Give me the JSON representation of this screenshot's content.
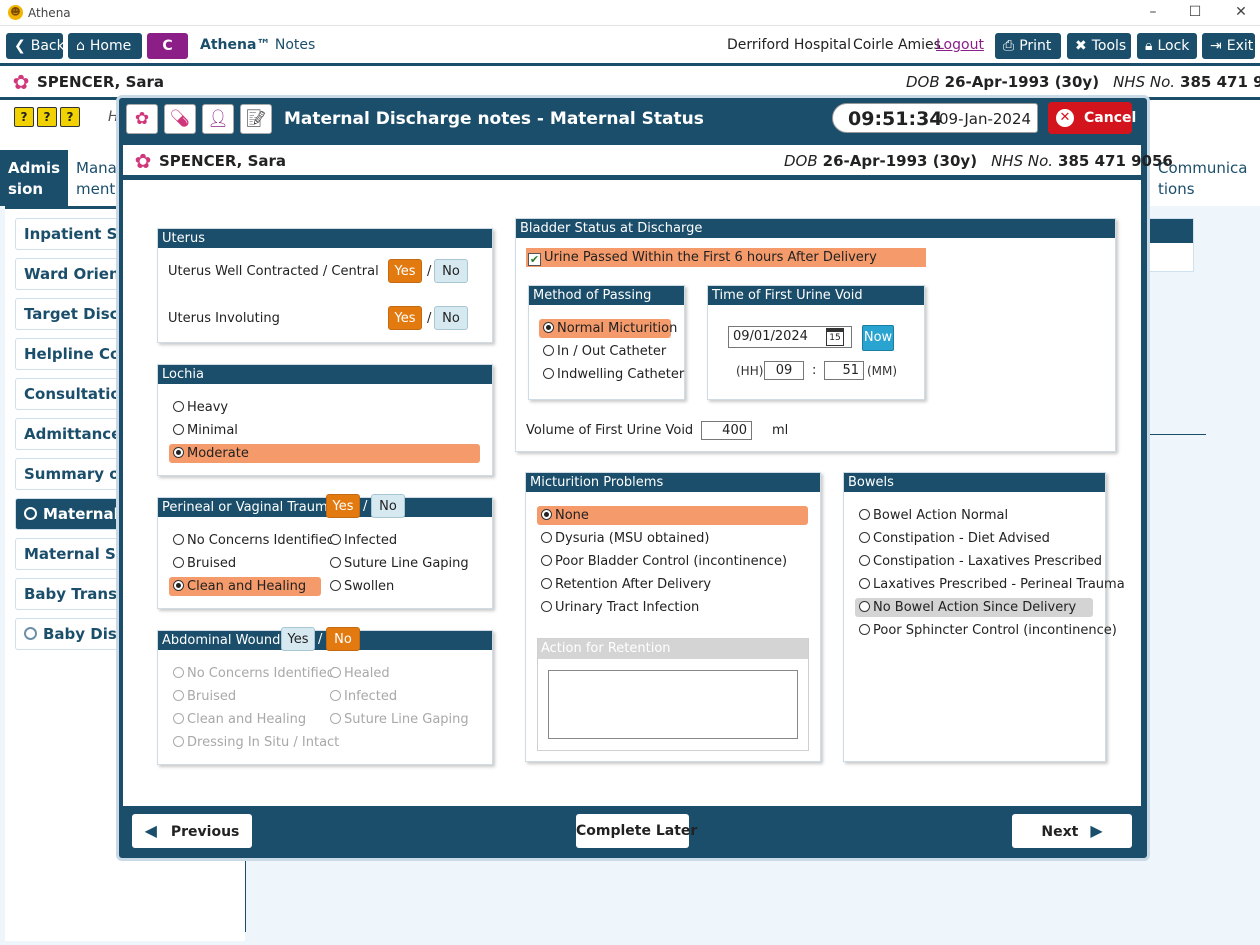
{
  "window": {
    "app_name": "Athena",
    "logo": "athena-logo",
    "minimize": "–",
    "maximize": "☐",
    "close": "✕"
  },
  "toolbar": {
    "back": "Back",
    "home": "Home",
    "c_label": "C",
    "product": "Athena™",
    "product_sub": "Notes",
    "hospital": "Derriford Hospital",
    "user": "Coirle Amies",
    "logout": "Logout",
    "print": "Print",
    "tools": "Tools",
    "lock": "Lock",
    "exit": "Exit"
  },
  "patient": {
    "name": "SPENCER, Sara",
    "dob_label": "DOB",
    "dob": "26-Apr-1993 (30y)",
    "nhs_label": "NHS No.",
    "nhs": "385 471 9056"
  },
  "help_icons": [
    "?",
    "?",
    "?"
  ],
  "background": {
    "tabs": {
      "admission": "Admis sion",
      "management": "Mana ment",
      "communications": "Communica tions"
    },
    "header_fragment": "H",
    "left_items": [
      {
        "label": "Inpatient Stay"
      },
      {
        "label": "Ward Orientat"
      },
      {
        "label": "Target Dischar"
      },
      {
        "label": "Helpline Conta"
      },
      {
        "label": "Consultation N"
      },
      {
        "label": "Admittance N"
      },
      {
        "label": "Summary of P"
      },
      {
        "label": "Maternal Di"
      },
      {
        "label": "Maternal Self"
      },
      {
        "label": "Baby Transfer"
      },
      {
        "label": "Baby Discha"
      }
    ]
  },
  "modal": {
    "title": "Maternal Discharge notes - Maternal Status",
    "time": "09:51:34",
    "date": "09-Jan-2024",
    "cancel": "Cancel",
    "uterus": {
      "title": "Uterus",
      "rows": [
        {
          "label": "Uterus Well Contracted / Central",
          "yes": "Yes",
          "no": "No",
          "selected": "Yes"
        },
        {
          "label": "Uterus Involuting",
          "yes": "Yes",
          "no": "No",
          "selected": "Yes"
        }
      ]
    },
    "lochia": {
      "title": "Lochia",
      "options": [
        "Heavy",
        "Minimal",
        "Moderate"
      ],
      "selected": "Moderate"
    },
    "perineal": {
      "title": "Perineal or Vaginal Trauma",
      "yes": "Yes",
      "no": "No",
      "selected": "Yes",
      "options": [
        "No Concerns Identified",
        "Infected",
        "Bruised",
        "Suture Line Gaping",
        "Clean and Healing",
        "Swollen"
      ],
      "checked": "Clean and Healing"
    },
    "abdominal": {
      "title": "Abdominal Wound",
      "yes": "Yes",
      "no": "No",
      "selected": "No",
      "options": [
        "No Concerns Identified",
        "Healed",
        "Bruised",
        "Infected",
        "Clean and Healing",
        "Suture Line Gaping",
        "Dressing In Situ / Intact"
      ]
    },
    "bladder": {
      "title": "Bladder Status at Discharge",
      "urine_passed": "Urine Passed Within the First 6 hours After Delivery",
      "urine_passed_checked": true,
      "method": {
        "title": "Method of Passing",
        "options": [
          "Normal Micturition",
          "In / Out Catheter",
          "Indwelling Catheter"
        ],
        "selected": "Normal Micturition"
      },
      "time_void": {
        "title": "Time of First Urine Void",
        "date": "09/01/2024",
        "calendar_day": "15",
        "now": "Now",
        "hh_label": "(HH)",
        "hh": "09",
        "colon": ":",
        "mm": "51",
        "mm_label": "(MM)"
      },
      "volume_label": "Volume of First Urine Void",
      "volume": "400",
      "volume_unit": "ml"
    },
    "micturition": {
      "title": "Micturition Problems",
      "options": [
        "None",
        "Dysuria (MSU obtained)",
        "Poor Bladder Control (incontinence)",
        "Retention After Delivery",
        "Urinary Tract Infection"
      ],
      "selected": "None",
      "retention_title": "Action for Retention",
      "retention_text": ""
    },
    "bowels": {
      "title": "Bowels",
      "options": [
        "Bowel Action Normal",
        "Constipation - Diet Advised",
        "Constipation - Laxatives Prescribed",
        "Laxatives Prescribed - Perineal Trauma",
        "No Bowel Action Since Delivery",
        "Poor Sphincter Control (incontinence)"
      ],
      "highlighted": "No Bowel Action Since Delivery"
    },
    "footer": {
      "previous": "Previous",
      "complete_later": "Complete Later",
      "next": "Next"
    }
  }
}
